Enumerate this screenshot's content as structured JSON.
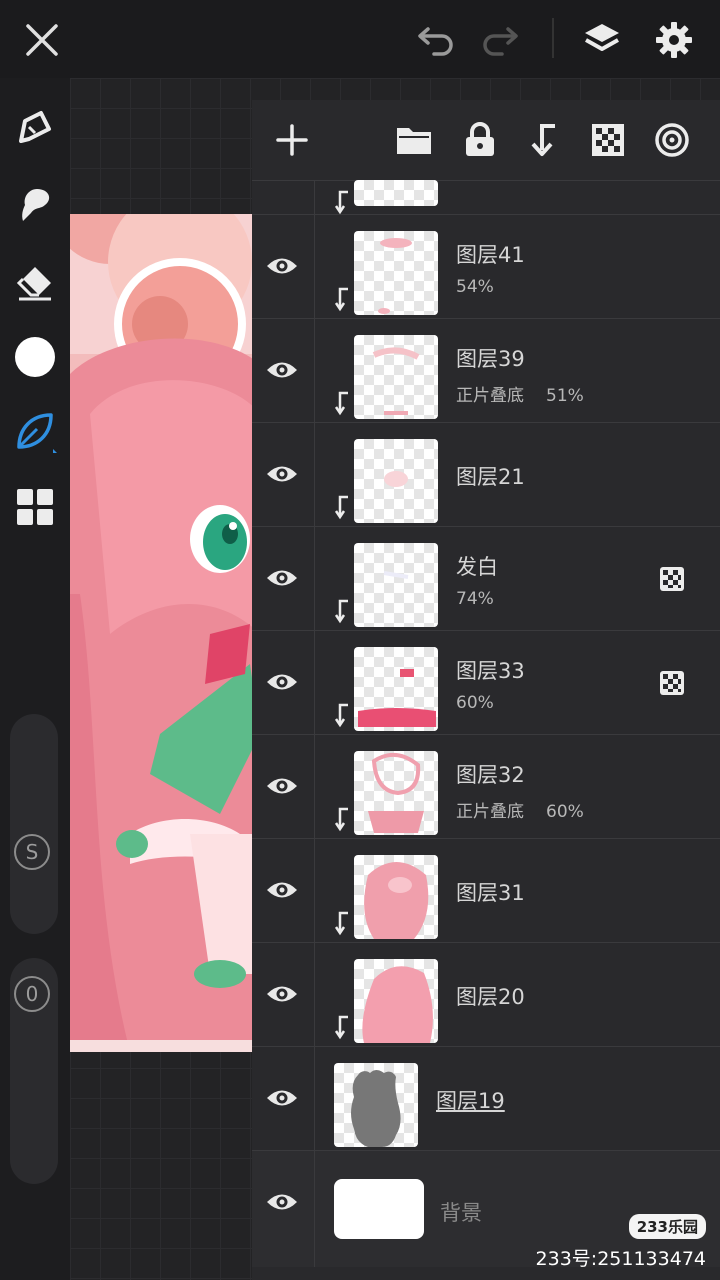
{
  "toolbar": {
    "close_icon": "close-icon",
    "undo_icon": "undo-icon",
    "redo_icon": "redo-icon",
    "layers_icon": "layers-icon",
    "settings_icon": "gear-icon"
  },
  "tools": [
    "pen-icon",
    "smudge-icon",
    "eraser-icon",
    "color-icon",
    "leaf-brush-icon",
    "grid-tools-icon"
  ],
  "sliders": {
    "size_label": "S",
    "opacity_label": "0"
  },
  "panel": {
    "header_icons": [
      "add-icon",
      "folder-icon",
      "lock-icon",
      "clip-icon",
      "alpha-icon",
      "reference-icon"
    ],
    "layers": [
      {
        "name": "图层41",
        "mode": "",
        "opacity": "54%",
        "clipped": true,
        "alpha_lock": false
      },
      {
        "name": "图层39",
        "mode": "正片叠底",
        "opacity": "51%",
        "clipped": true,
        "alpha_lock": false
      },
      {
        "name": "图层21",
        "mode": "",
        "opacity": "",
        "clipped": true,
        "alpha_lock": false
      },
      {
        "name": "发白",
        "mode": "",
        "opacity": "74%",
        "clipped": true,
        "alpha_lock": true
      },
      {
        "name": "图层33",
        "mode": "",
        "opacity": "60%",
        "clipped": true,
        "alpha_lock": true
      },
      {
        "name": "图层32",
        "mode": "正片叠底",
        "opacity": "60%",
        "clipped": true,
        "alpha_lock": false
      },
      {
        "name": "图层31",
        "mode": "",
        "opacity": "",
        "clipped": true,
        "alpha_lock": false
      },
      {
        "name": "图层20",
        "mode": "",
        "opacity": "",
        "clipped": true,
        "alpha_lock": false
      },
      {
        "name": "图层19",
        "mode": "",
        "opacity": "",
        "clipped": false,
        "alpha_lock": false
      },
      {
        "name": "背景",
        "mode": "",
        "opacity": "",
        "clipped": false,
        "alpha_lock": false
      }
    ]
  },
  "watermark": "233乐园",
  "user_id": "233号:251133474"
}
